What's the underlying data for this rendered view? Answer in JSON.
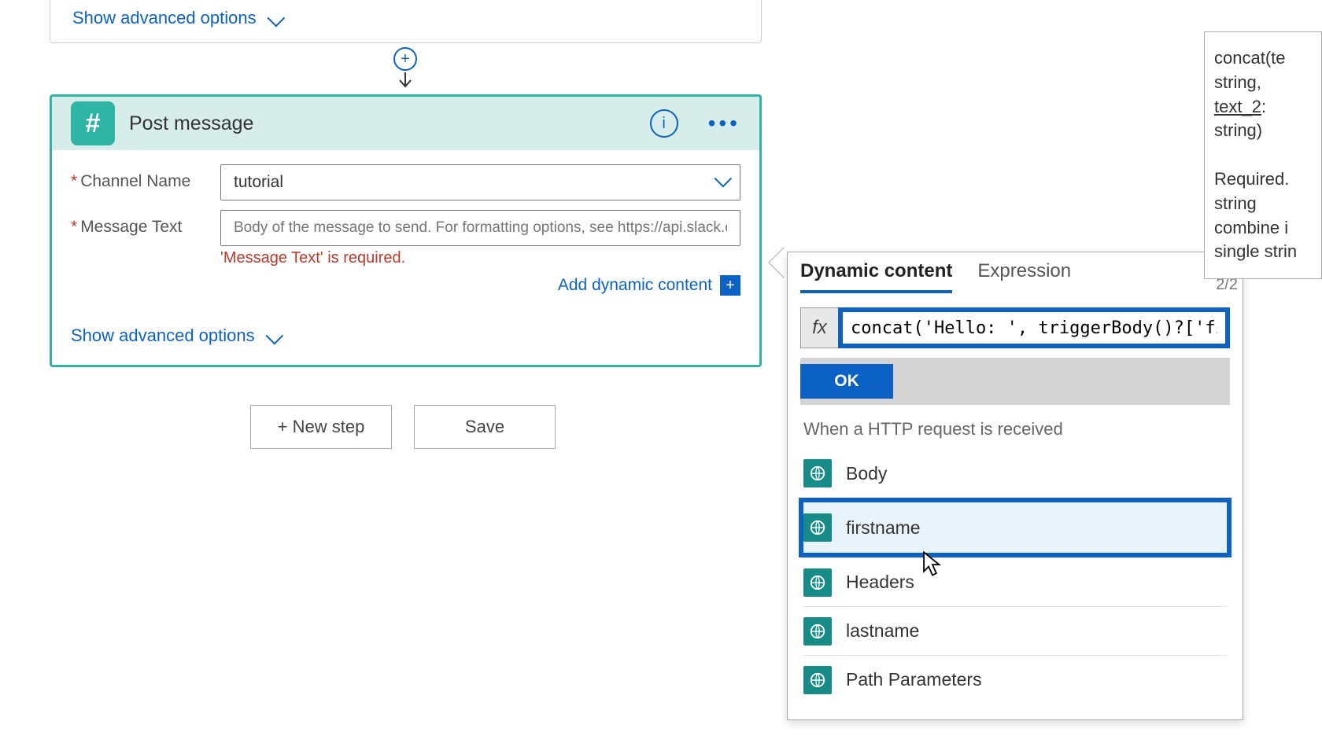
{
  "previous_card": {
    "advanced_label": "Show advanced options"
  },
  "card": {
    "title": "Post message",
    "fields": {
      "channel": {
        "label": "Channel Name",
        "value": "tutorial"
      },
      "message": {
        "label": "Message Text",
        "placeholder": "Body of the message to send. For formatting options, see https://api.slack.com.",
        "error": "'Message Text' is required."
      }
    },
    "add_dynamic_label": "Add dynamic content",
    "advanced_label": "Show advanced options"
  },
  "buttons": {
    "new_step": "+ New step",
    "save": "Save"
  },
  "panel": {
    "tabs": {
      "dynamic": "Dynamic content",
      "expression": "Expression"
    },
    "counter": "2/2",
    "fx_label": "fx",
    "expression_value": "concat('Hello: ', triggerBody()?['firstnam",
    "ok": "OK",
    "source_header": "When a HTTP request is received",
    "params": [
      "Body",
      "firstname",
      "Headers",
      "lastname",
      "Path Parameters"
    ]
  },
  "help": {
    "line1": "concat(te",
    "line2": "string,",
    "line3_underlined": "text_2",
    "line3_rest": ":",
    "line4": "string)",
    "body1": "Required.",
    "body2": "string",
    "body3": "combine i",
    "body4": "single strin"
  }
}
